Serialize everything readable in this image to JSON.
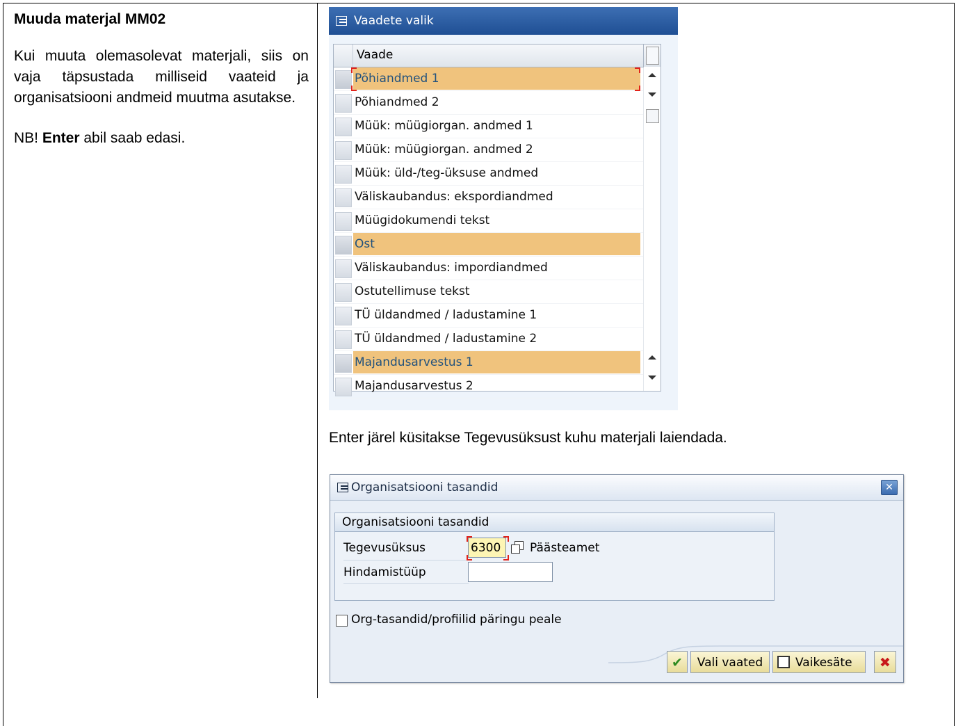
{
  "left": {
    "title": "Muuda materjal MM02",
    "paragraph": "Kui muuta olemasolevat materjali, siis on vaja täpsustada milliseid vaateid ja organisatsiooni andmeid muutma asutakse.",
    "nb_prefix": "NB! ",
    "nb_bold": "Enter",
    "nb_suffix": " abil saab edasi."
  },
  "views_window": {
    "title": "Vaadete valik",
    "column_header": "Vaade",
    "rows": [
      {
        "label": "Põhiandmed 1",
        "selected": true
      },
      {
        "label": "Põhiandmed 2",
        "selected": false
      },
      {
        "label": "Müük: müügiorgan. andmed 1",
        "selected": false
      },
      {
        "label": "Müük: müügiorgan. andmed 2",
        "selected": false
      },
      {
        "label": "Müük: üld-/teg-üksuse andmed",
        "selected": false
      },
      {
        "label": "Väliskaubandus: ekspordiandmed",
        "selected": false
      },
      {
        "label": "Müügidokumendi tekst",
        "selected": false
      },
      {
        "label": "Ost",
        "selected": true
      },
      {
        "label": "Väliskaubandus: impordiandmed",
        "selected": false
      },
      {
        "label": "Ostutellimuse tekst",
        "selected": false
      },
      {
        "label": "TÜ üldandmed / ladustamine 1",
        "selected": false
      },
      {
        "label": "TÜ üldandmed / ladustamine 2",
        "selected": false
      },
      {
        "label": "Majandusarvestus 1",
        "selected": true
      },
      {
        "label": "Majandusarvestus 2",
        "selected": false
      }
    ],
    "highlight_color": "#f0c37d"
  },
  "caption": "Enter järel küsitakse Tegevusüksust kuhu materjali laiendada.",
  "org_dialog": {
    "title": "Organisatsiooni tasandid",
    "close_glyph": "✕",
    "group_title": "Organisatsiooni tasandid",
    "fields": {
      "tegevusuksus_label": "Tegevusüksus",
      "tegevusuksus_value": "6300",
      "tegevusuksus_desc": "Päästeamet",
      "hindamistuup_label": "Hindamistüüp",
      "hindamistuup_value": ""
    },
    "checkbox_label": "Org-tasandid/profiilid päringu peale",
    "checkbox_checked": false,
    "buttons": {
      "ok_glyph": "✔",
      "vali_vaated": "Vali vaated",
      "vaikesate": "Vaikesäte",
      "cancel_glyph": "✖"
    }
  }
}
